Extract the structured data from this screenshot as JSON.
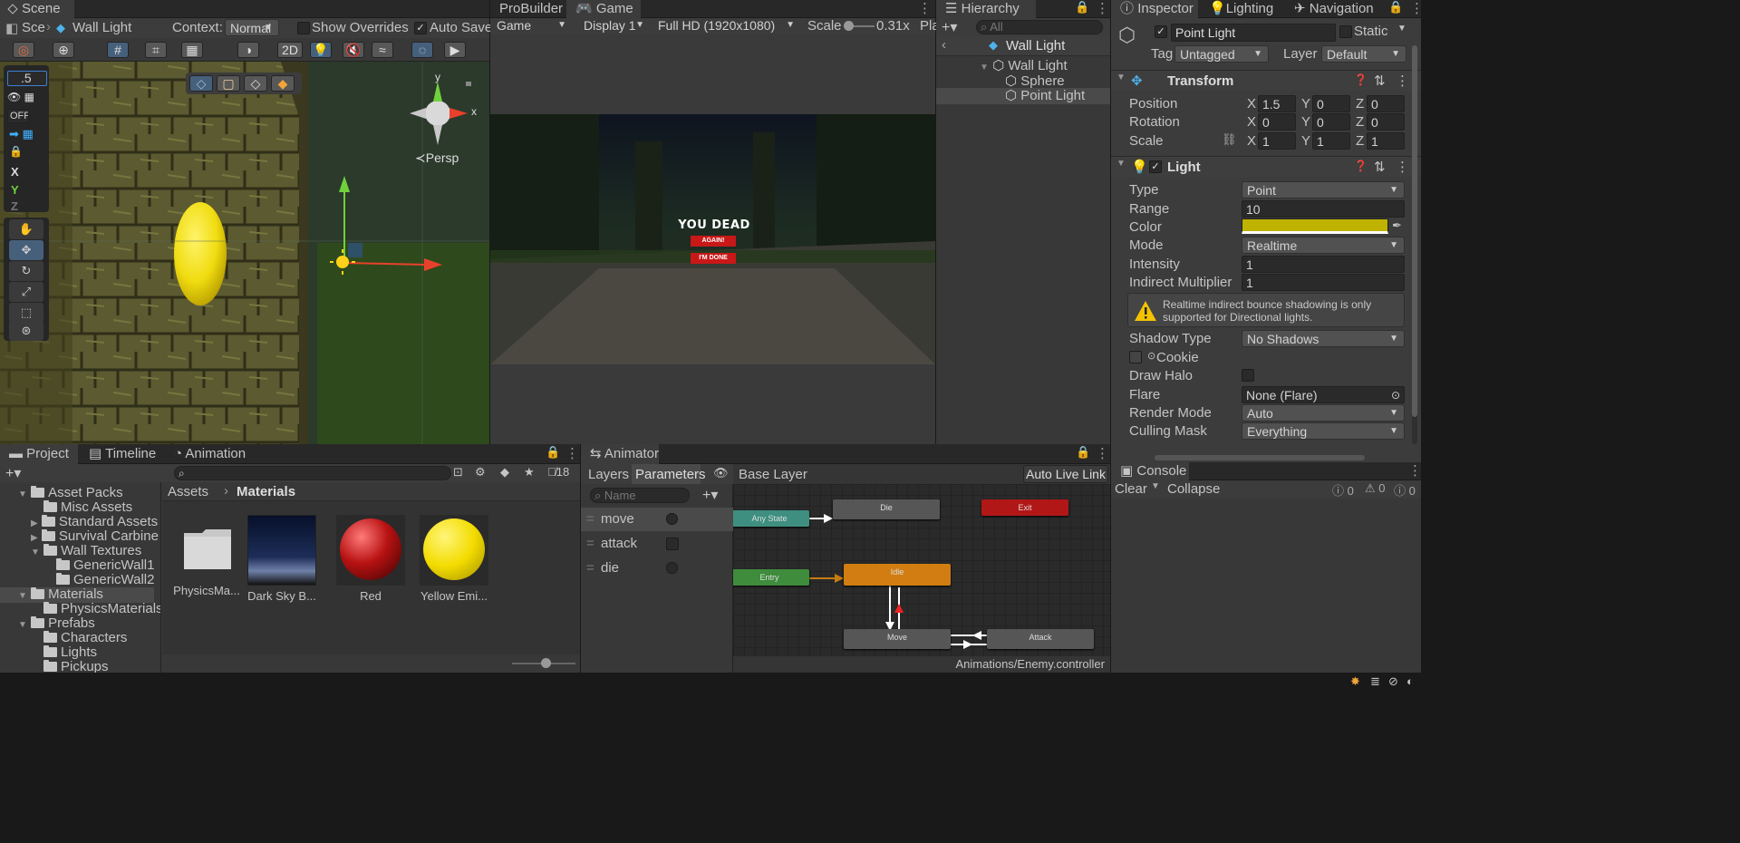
{
  "scene": {
    "tab": "Scene",
    "breadcrumb_short": "Sce",
    "object": "Wall Light",
    "context_label": "Context:",
    "context_value": "Normal",
    "show_overrides": "Show Overrides",
    "auto_save": "Auto Save",
    "btn_2d": "2D",
    "persp": "Persp",
    "snap_value": ".5",
    "off_label": "OFF",
    "axis_x": "X",
    "axis_y": "Y",
    "axis_z": "Z",
    "gizmo_y": "y",
    "gizmo_x": "x"
  },
  "game": {
    "tab_probuilder": "ProBuilder",
    "tab_game": "Game",
    "mode": "Game",
    "display": "Display 1",
    "resolution": "Full HD (1920x1080)",
    "scale_label": "Scale",
    "scale_value": "0.31x",
    "play_short": "Pla",
    "title_text": "YOU DEAD",
    "btn_again": "AGAIN!",
    "btn_done": "I'M DONE"
  },
  "hierarchy": {
    "tab": "Hierarchy",
    "search_placeholder": "All",
    "root": "Wall Light",
    "items": [
      {
        "label": "Wall Light"
      },
      {
        "label": "Sphere"
      },
      {
        "label": "Point Light"
      }
    ]
  },
  "inspector": {
    "tab": "Inspector",
    "tab_lighting": "Lighting",
    "tab_navigation": "Navigation",
    "object_name": "Point Light",
    "static": "Static",
    "tag_label": "Tag",
    "tag_value": "Untagged",
    "layer_label": "Layer",
    "layer_value": "Default",
    "transform": {
      "title": "Transform",
      "position_label": "Position",
      "rotation_label": "Rotation",
      "scale_label": "Scale",
      "x": "X",
      "y": "Y",
      "z": "Z",
      "position": [
        "1.5",
        "0",
        "0"
      ],
      "rotation": [
        "0",
        "0",
        "0"
      ],
      "scale": [
        "1",
        "1",
        "1"
      ]
    },
    "light": {
      "title": "Light",
      "type_label": "Type",
      "type_value": "Point",
      "range_label": "Range",
      "range_value": "10",
      "color_label": "Color",
      "color_value": "#bfb300",
      "mode_label": "Mode",
      "mode_value": "Realtime",
      "intensity_label": "Intensity",
      "intensity_value": "1",
      "indirect_label": "Indirect Multiplier",
      "indirect_value": "1",
      "warning": "Realtime indirect bounce shadowing is only supported for Directional lights.",
      "shadow_label": "Shadow Type",
      "shadow_value": "No Shadows",
      "cookie_label": "Cookie",
      "halo_label": "Draw Halo",
      "flare_label": "Flare",
      "flare_value": "None (Flare)",
      "render_label": "Render Mode",
      "render_value": "Auto",
      "culling_label": "Culling Mask",
      "culling_value": "Everything"
    }
  },
  "project": {
    "tab": "Project",
    "tab_timeline": "Timeline",
    "tab_animation": "Animation",
    "hidden_count": "18",
    "breadcrumb_root": "Assets",
    "breadcrumb_current": "Materials",
    "tree": [
      {
        "label": "Asset Packs"
      },
      {
        "label": "Misc Assets"
      },
      {
        "label": "Standard Assets"
      },
      {
        "label": "Survival Carbine"
      },
      {
        "label": "Wall Textures"
      },
      {
        "label": "GenericWall1"
      },
      {
        "label": "GenericWall2"
      },
      {
        "label": "Materials"
      },
      {
        "label": "PhysicsMaterials"
      },
      {
        "label": "Prefabs"
      },
      {
        "label": "Characters"
      },
      {
        "label": "Lights"
      },
      {
        "label": "Pickups"
      }
    ],
    "assets": [
      {
        "label": "PhysicsMa..."
      },
      {
        "label": "Dark Sky B..."
      },
      {
        "label": "Red"
      },
      {
        "label": "Yellow Emi..."
      }
    ]
  },
  "animator": {
    "tab": "Animator",
    "tab_layers": "Layers",
    "tab_parameters": "Parameters",
    "base_layer": "Base Layer",
    "auto_live_link": "Auto Live Link",
    "name_placeholder": "Name",
    "params": [
      {
        "label": "move"
      },
      {
        "label": "attack"
      },
      {
        "label": "die"
      }
    ],
    "states": {
      "any_state": "Any State",
      "die": "Die",
      "exit": "Exit",
      "entry": "Entry",
      "idle": "Idle",
      "move": "Move",
      "attack": "Attack"
    },
    "path": "Animations/Enemy.controller"
  },
  "console": {
    "tab": "Console",
    "clear": "Clear",
    "collapse": "Collapse",
    "counts": [
      "0",
      "0",
      "0"
    ]
  }
}
